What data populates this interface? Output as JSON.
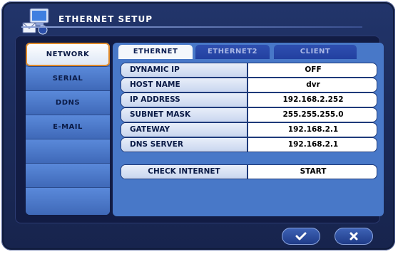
{
  "window": {
    "title": "ETHERNET SETUP"
  },
  "sidebar": {
    "items": [
      {
        "label": "NETWORK",
        "active": true
      },
      {
        "label": "SERIAL"
      },
      {
        "label": "DDNS"
      },
      {
        "label": "E-MAIL"
      },
      {
        "label": ""
      },
      {
        "label": ""
      },
      {
        "label": ""
      }
    ]
  },
  "tabs": [
    {
      "label": "ETHERNET",
      "active": true
    },
    {
      "label": "ETHERNET2"
    },
    {
      "label": "CLIENT"
    }
  ],
  "settings": [
    {
      "label": "DYNAMIC IP",
      "value": "OFF"
    },
    {
      "label": "HOST NAME",
      "value": "dvr"
    },
    {
      "label": "IP ADDRESS",
      "value": "192.168.2.252"
    },
    {
      "label": "SUBNET MASK",
      "value": "255.255.255.0"
    },
    {
      "label": "GATEWAY",
      "value": "192.168.2.1"
    },
    {
      "label": "DNS SERVER",
      "value": "192.168.2.1"
    }
  ],
  "check_internet": {
    "label": "CHECK INTERNET",
    "action": "START"
  },
  "buttons": {
    "ok_icon": "check-icon",
    "cancel_icon": "close-icon"
  },
  "colors": {
    "accent": "#4878c8",
    "active_outline": "#e08a2a",
    "background": "#1c2c5c"
  }
}
